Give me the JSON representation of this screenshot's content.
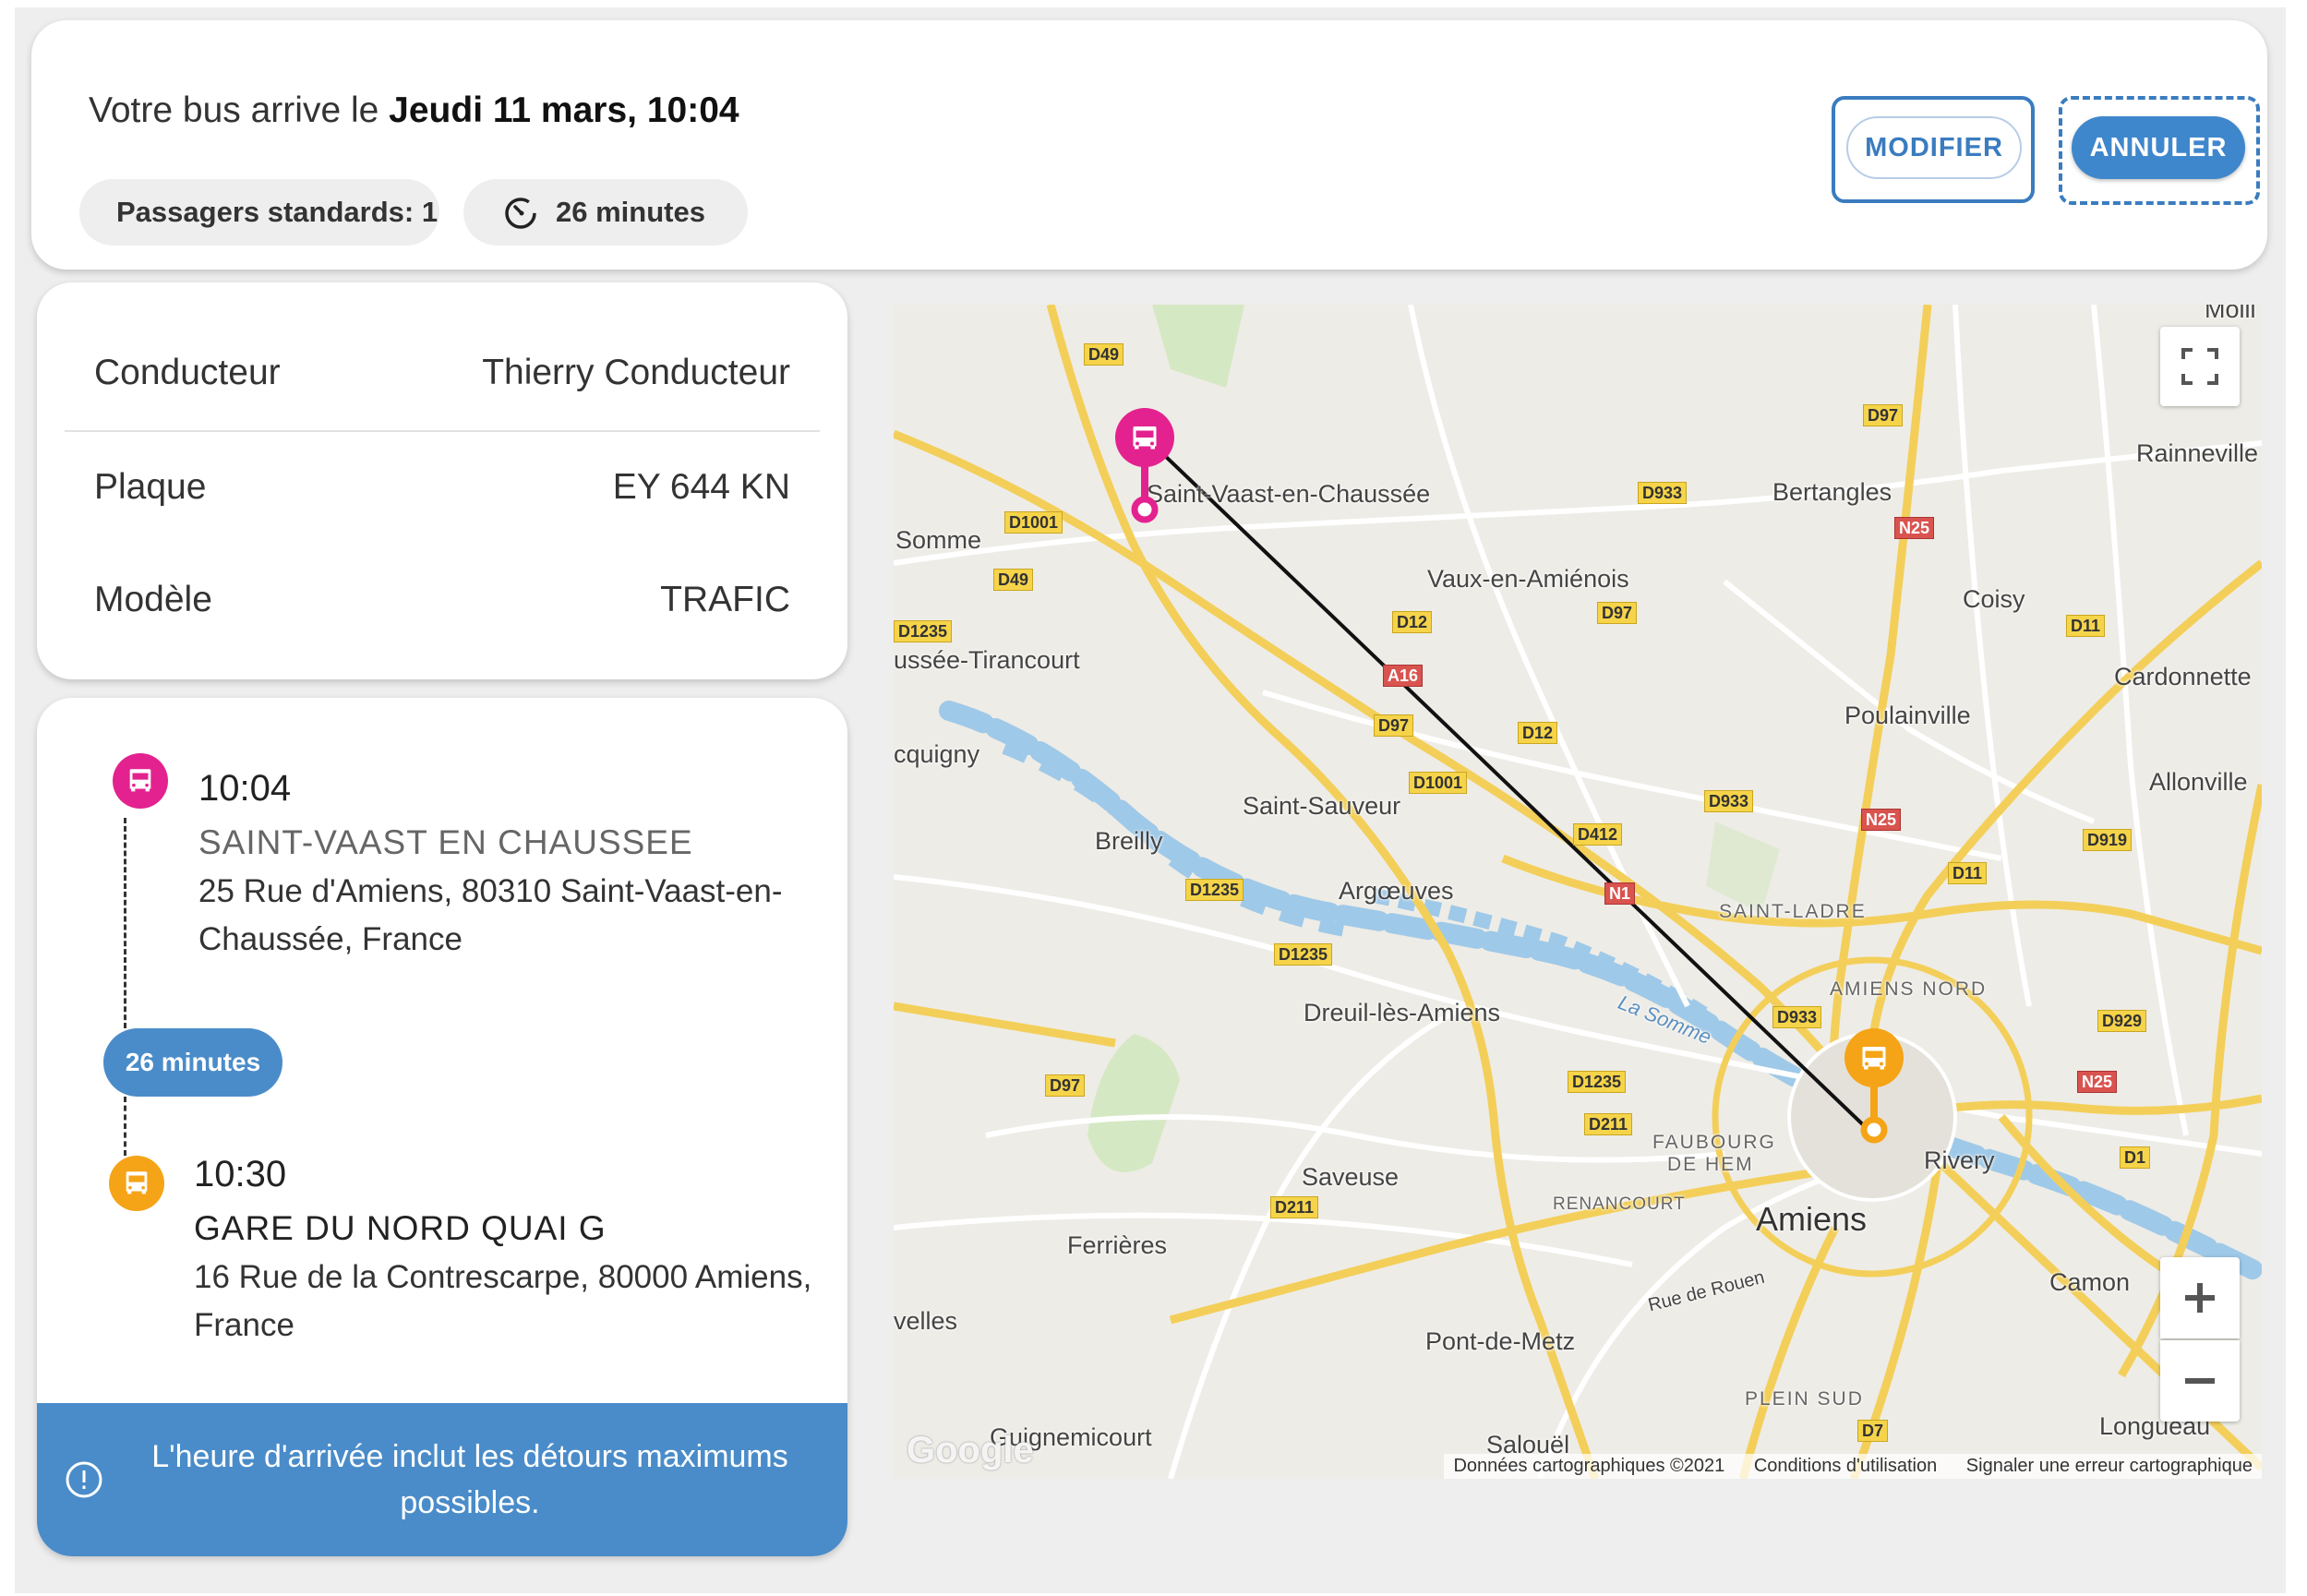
{
  "header": {
    "arrive_prefix": "Votre bus arrive le",
    "arrive_datetime": "Jeudi 11 mars, 10:04",
    "passengers_chip": "Passagers standards: 1",
    "duration_chip": "26 minutes",
    "modify_label": "MODIFIER",
    "cancel_label": "ANNULER"
  },
  "driver": {
    "rows": [
      {
        "label": "Conducteur",
        "value": "Thierry Conducteur"
      },
      {
        "label": "Plaque",
        "value": "EY 644 KN"
      },
      {
        "label": "Modèle",
        "value": "TRAFIC"
      }
    ]
  },
  "trip": {
    "departure": {
      "time": "10:04",
      "name": "SAINT-VAAST EN CHAUSSEE",
      "address": "25 Rue d'Amiens, 80310 Saint-Vaast-en-Chaussée, France"
    },
    "duration": "26 minutes",
    "arrival": {
      "time": "10:30",
      "name": "GARE DU NORD QUAI G",
      "address": "16 Rue de la Contrescarpe, 80000 Amiens, France"
    },
    "notice": "L'heure d'arrivée inclut les détours maximums possibles."
  },
  "map": {
    "places": {
      "moll": "Molli",
      "rainneville": "Rainneville",
      "saint_vaast": "Saint-Vaast-en-Chaussée",
      "bertangles": "Bertangles",
      "somme": "Somme",
      "vaux": "Vaux-en-Amiénois",
      "coisy": "Coisy",
      "tirancourt": "ussée-Tirancourt",
      "cardonnette": "Cardonnette",
      "poulainville": "Poulainville",
      "cquigny": "cquigny",
      "allonville": "Allonville",
      "saint_sauveur": "Saint-Sauveur",
      "breilly": "Breilly",
      "argoeuves": "Argœuves",
      "saint_ladre": "SAINT-LADRE",
      "amiens_nord": "AMIENS NORD",
      "dreuil": "Dreuil-lès-Amiens",
      "la_somme": "La Somme",
      "faubourg": "FAUBOURG",
      "de_hem": "DE HEM",
      "rivery": "Rivery",
      "saveuse": "Saveuse",
      "renancourt": "RENANCOURT",
      "amiens": "Amiens",
      "ferrieres": "Ferrières",
      "camon": "Camon",
      "rue_de_rouen": "Rue de Rouen",
      "velles": "velles",
      "pont_de_metz": "Pont-de-Metz",
      "plein_sud": "PLEIN SUD",
      "guignemicourt": "Guignemicourt",
      "salouel": "Salouël",
      "longueau": "Longueau"
    },
    "roads": {
      "d49a": "D49",
      "d97a": "D97",
      "d933a": "D933",
      "n25a": "N25",
      "d1001a": "D1001",
      "d49b": "D49",
      "d12a": "D12",
      "d97b": "D97",
      "d11a": "D11",
      "d1235a": "D1235",
      "a16": "A16",
      "d97c": "D97",
      "d12b": "D12",
      "d1001b": "D1001",
      "d933b": "D933",
      "n25b": "N25",
      "d412": "D412",
      "d919": "D919",
      "d11b": "D11",
      "d1235b": "D1235",
      "n1": "N1",
      "d1235c": "D1235",
      "d933c": "D933",
      "d929": "D929",
      "d97d": "D97",
      "d1235d": "D1235",
      "n25c": "N25",
      "d211a": "D211",
      "d1": "D1",
      "d211b": "D211",
      "d7": "D7"
    },
    "logo": "Google",
    "attribution": {
      "data": "Données cartographiques ©2021",
      "terms": "Conditions d'utilisation",
      "report": "Signaler une erreur cartographique"
    },
    "colors": {
      "departure": "#e3228f",
      "arrival": "#f5a417",
      "accent": "#3f87cc",
      "water": "#9fc9e8"
    }
  }
}
